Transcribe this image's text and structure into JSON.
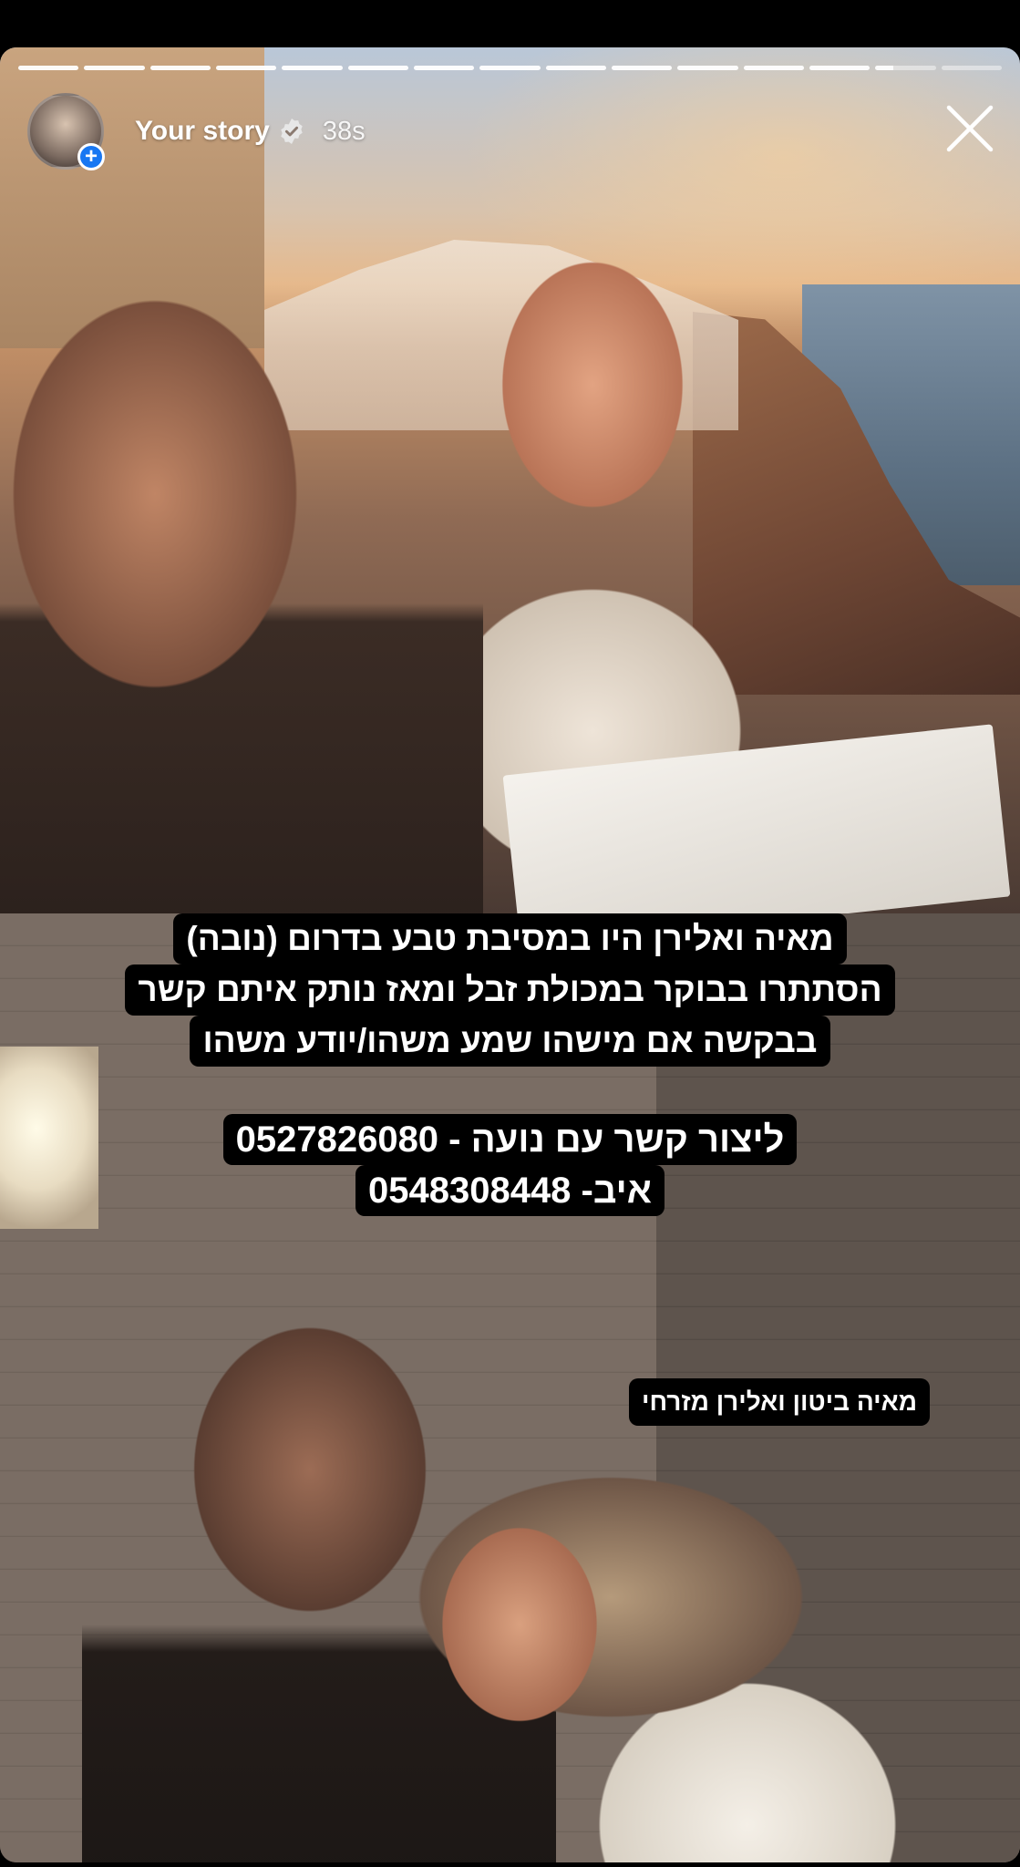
{
  "story": {
    "title": "Your story",
    "time": "38s",
    "progress_segments_total": 15,
    "progress_segments_viewed": 13,
    "current_segment_progress": 0.3,
    "avatar_icon": "avatar",
    "add_icon": "plus-icon",
    "verified_icon": "verified-badge-icon",
    "close_icon": "close-icon"
  },
  "overlay": {
    "message_lines": [
      "מאיה ואלירן היו במסיבת טבע בדרום (נובה)",
      "הסתתרו בבוקר במכולת זבל ומאז נותק איתם קשר",
      "בבקשה אם מישהו שמע משהו/יודע משהו"
    ],
    "contact_lines": [
      "ליצור קשר עם נועה - 0527826080",
      "איב- 0548308448"
    ],
    "names_label": "מאיה ביטון ואלירן מזרחי"
  },
  "colors": {
    "accent": "#1877f2",
    "sticker_bg": "#000000",
    "text": "#ffffff"
  }
}
